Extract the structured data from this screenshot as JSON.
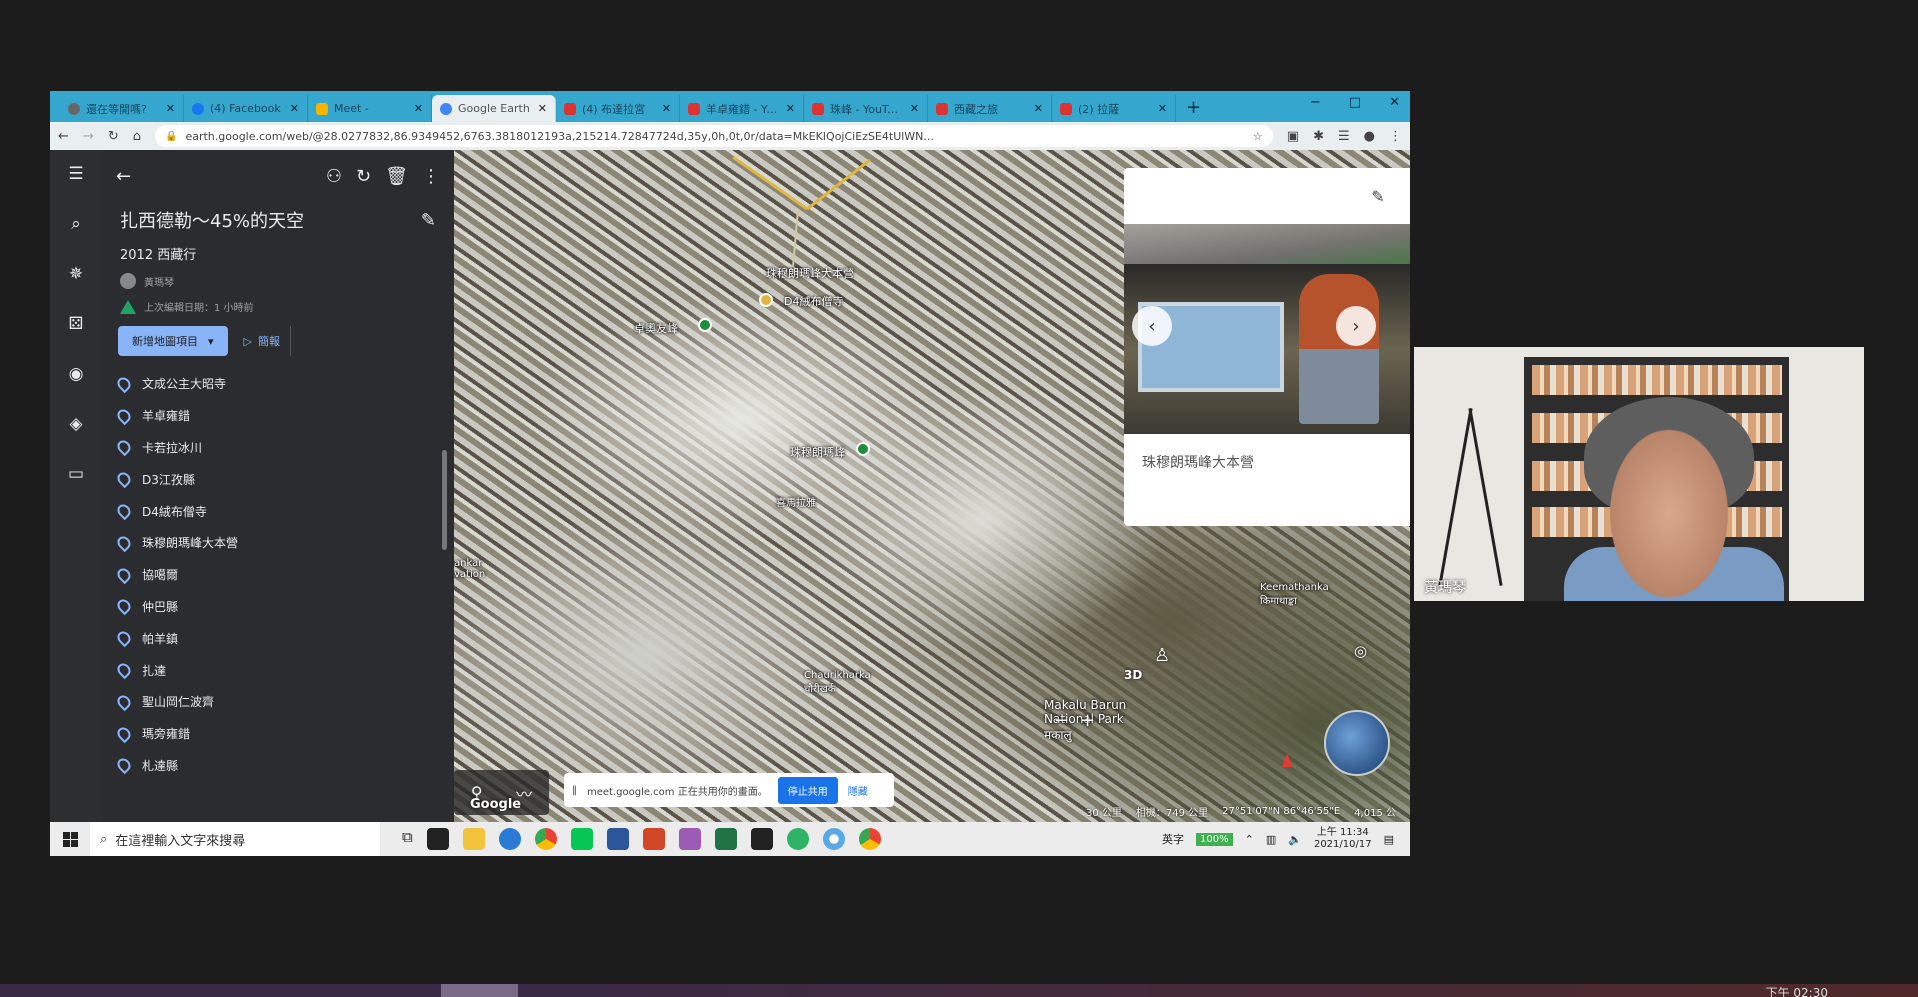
{
  "browser": {
    "tabs": [
      {
        "title": "還在等開嗎?",
        "icon": "w"
      },
      {
        "title": "(4) Facebook",
        "icon": "fb"
      },
      {
        "title": "Meet -",
        "icon": "y"
      },
      {
        "title": "Google Earth",
        "icon": "g",
        "active": true
      },
      {
        "title": "(4) 布達拉宮",
        "icon": "yt"
      },
      {
        "title": "羊卓雍錯 - YouTube",
        "icon": "yt"
      },
      {
        "title": "珠峰 - YouTube",
        "icon": "yt"
      },
      {
        "title": "西藏之旅",
        "icon": "yt"
      },
      {
        "title": "(2) 拉薩",
        "icon": "yt"
      }
    ],
    "new_tab": "+",
    "window_controls": [
      "−",
      "□",
      "✕"
    ],
    "url": "earth.google.com/web/@28.0277832,86.9349452,6763.3818012193a,215214.72847724d,35y,0h,0t,0r/data=MkEKIQojCiEzSE4tUlWN..."
  },
  "earth": {
    "project_title": "扎西德勒～45%的天空",
    "project_subtitle": "2012 西藏行",
    "author": "黃瑪琴",
    "drive_text": "上次編輯日期：1 小時前",
    "new_feature_button": "新增地圖項目",
    "present_button": "簡報",
    "features": [
      "文成公主大昭寺",
      "羊卓雍錯",
      "卡若拉冰川",
      "D3江孜縣",
      "D4絨布僧寺",
      "珠穆朗瑪峰大本營",
      "協噶爾",
      "仲巴縣",
      "帕羊鎮",
      "扎達",
      "聖山岡仁波齊",
      "瑪旁雍錯",
      "札達縣"
    ],
    "map_labels": {
      "rongbuk": "珠穆朗瑪峰大本營",
      "d4": "D4絨布僧寺",
      "everest_green": "珠穆朗瑪峰",
      "kangshung": "卓奧友峰",
      "nepal_peak": "喜馬拉雅",
      "chukhung": "Chaurikharka\nचौरीखर्क",
      "makalu": "Makalu Barun\nNational Park\nमकालु",
      "keemathanka": "Keemathanka\nकिमाथाङ्का",
      "khumbu": "ankar\nvation"
    },
    "map_ctrl_3d": "3D",
    "google_logo": "Google",
    "scale": "30 公里",
    "camera": "相機：749 公里",
    "coords": "27°51'07\"N 86°46'55\"E",
    "elevation": "4,015 公",
    "share_banner": {
      "text": "meet.google.com 正在共用你的畫面。",
      "stop": "停止共用",
      "hide": "隱藏"
    },
    "infocard": {
      "caption": "珠穆朗瑪峰大本營"
    }
  },
  "taskbar": {
    "search_placeholder": "在這裡輸入文字來搜尋",
    "ime": "英字",
    "battery": "100%",
    "time": "上午 11:34",
    "date": "2021/10/17"
  },
  "webcam": {
    "name": "黃瑪琴"
  },
  "host": {
    "clock": "下午 02:30"
  }
}
